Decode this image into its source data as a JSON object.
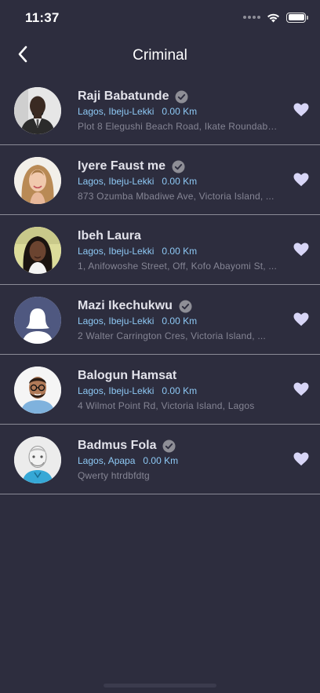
{
  "status_bar": {
    "time": "11:37"
  },
  "nav": {
    "title": "Criminal"
  },
  "colors": {
    "background": "#2d2d3e",
    "accent": "#8ec9f5",
    "heart": "#d8d6f7",
    "verified": "#8e8e96"
  },
  "items": [
    {
      "name": "Raji Babatunde",
      "verified": true,
      "location": "Lagos, Ibeju-Lekki",
      "distance": "0.00 Km",
      "address": "Plot 8 Elegushi Beach Road, Ikate Roundabo...",
      "avatar": "man-suit-photo"
    },
    {
      "name": "Iyere Faust me",
      "verified": true,
      "location": "Lagos, Ibeju-Lekki",
      "distance": "0.00 Km",
      "address": "873 Ozumba Mbadiwe Ave, Victoria Island, ...",
      "avatar": "woman-blonde-photo"
    },
    {
      "name": "Ibeh Laura",
      "verified": false,
      "location": "Lagos, Ibeju-Lekki",
      "distance": "0.00 Km",
      "address": "1, Anifowoshe Street, Off, Kofo Abayomi St, ...",
      "avatar": "woman-dark-hair-photo"
    },
    {
      "name": "Mazi Ikechukwu",
      "verified": true,
      "location": "Lagos, Ibeju-Lekki",
      "distance": "0.00 Km",
      "address": "2 Walter Carrington Cres, Victoria Island, ...",
      "avatar": "default-avatar-silhouette"
    },
    {
      "name": "Balogun Hamsat",
      "verified": false,
      "location": "Lagos, Ibeju-Lekki",
      "distance": "0.00 Km",
      "address": "4 Wilmot Point Rd, Victoria Island, Lagos",
      "avatar": "man-glasses-photo"
    },
    {
      "name": "Badmus Fola",
      "verified": true,
      "location": "Lagos, Apapa",
      "distance": "0.00 Km",
      "address": "Qwerty htrdbfdtg",
      "avatar": "man-illustration-photo"
    }
  ]
}
